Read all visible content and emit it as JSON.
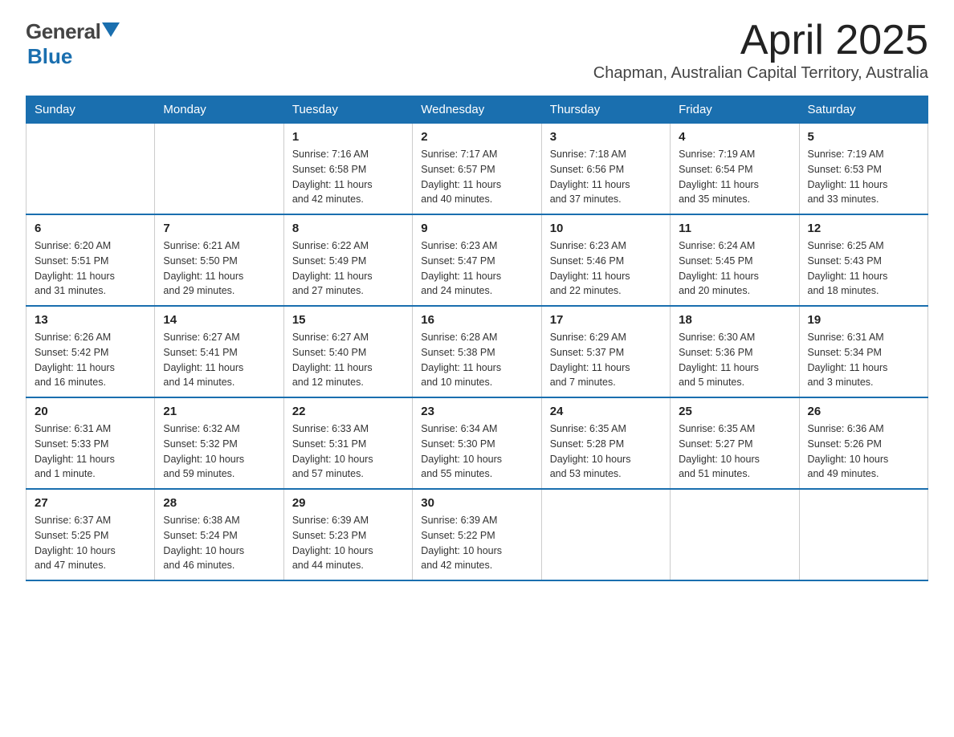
{
  "header": {
    "logo_general": "General",
    "logo_blue": "Blue",
    "month_title": "April 2025",
    "location": "Chapman, Australian Capital Territory, Australia"
  },
  "days_of_week": [
    "Sunday",
    "Monday",
    "Tuesday",
    "Wednesday",
    "Thursday",
    "Friday",
    "Saturday"
  ],
  "weeks": [
    [
      {
        "day": "",
        "info": ""
      },
      {
        "day": "",
        "info": ""
      },
      {
        "day": "1",
        "info": "Sunrise: 7:16 AM\nSunset: 6:58 PM\nDaylight: 11 hours\nand 42 minutes."
      },
      {
        "day": "2",
        "info": "Sunrise: 7:17 AM\nSunset: 6:57 PM\nDaylight: 11 hours\nand 40 minutes."
      },
      {
        "day": "3",
        "info": "Sunrise: 7:18 AM\nSunset: 6:56 PM\nDaylight: 11 hours\nand 37 minutes."
      },
      {
        "day": "4",
        "info": "Sunrise: 7:19 AM\nSunset: 6:54 PM\nDaylight: 11 hours\nand 35 minutes."
      },
      {
        "day": "5",
        "info": "Sunrise: 7:19 AM\nSunset: 6:53 PM\nDaylight: 11 hours\nand 33 minutes."
      }
    ],
    [
      {
        "day": "6",
        "info": "Sunrise: 6:20 AM\nSunset: 5:51 PM\nDaylight: 11 hours\nand 31 minutes."
      },
      {
        "day": "7",
        "info": "Sunrise: 6:21 AM\nSunset: 5:50 PM\nDaylight: 11 hours\nand 29 minutes."
      },
      {
        "day": "8",
        "info": "Sunrise: 6:22 AM\nSunset: 5:49 PM\nDaylight: 11 hours\nand 27 minutes."
      },
      {
        "day": "9",
        "info": "Sunrise: 6:23 AM\nSunset: 5:47 PM\nDaylight: 11 hours\nand 24 minutes."
      },
      {
        "day": "10",
        "info": "Sunrise: 6:23 AM\nSunset: 5:46 PM\nDaylight: 11 hours\nand 22 minutes."
      },
      {
        "day": "11",
        "info": "Sunrise: 6:24 AM\nSunset: 5:45 PM\nDaylight: 11 hours\nand 20 minutes."
      },
      {
        "day": "12",
        "info": "Sunrise: 6:25 AM\nSunset: 5:43 PM\nDaylight: 11 hours\nand 18 minutes."
      }
    ],
    [
      {
        "day": "13",
        "info": "Sunrise: 6:26 AM\nSunset: 5:42 PM\nDaylight: 11 hours\nand 16 minutes."
      },
      {
        "day": "14",
        "info": "Sunrise: 6:27 AM\nSunset: 5:41 PM\nDaylight: 11 hours\nand 14 minutes."
      },
      {
        "day": "15",
        "info": "Sunrise: 6:27 AM\nSunset: 5:40 PM\nDaylight: 11 hours\nand 12 minutes."
      },
      {
        "day": "16",
        "info": "Sunrise: 6:28 AM\nSunset: 5:38 PM\nDaylight: 11 hours\nand 10 minutes."
      },
      {
        "day": "17",
        "info": "Sunrise: 6:29 AM\nSunset: 5:37 PM\nDaylight: 11 hours\nand 7 minutes."
      },
      {
        "day": "18",
        "info": "Sunrise: 6:30 AM\nSunset: 5:36 PM\nDaylight: 11 hours\nand 5 minutes."
      },
      {
        "day": "19",
        "info": "Sunrise: 6:31 AM\nSunset: 5:34 PM\nDaylight: 11 hours\nand 3 minutes."
      }
    ],
    [
      {
        "day": "20",
        "info": "Sunrise: 6:31 AM\nSunset: 5:33 PM\nDaylight: 11 hours\nand 1 minute."
      },
      {
        "day": "21",
        "info": "Sunrise: 6:32 AM\nSunset: 5:32 PM\nDaylight: 10 hours\nand 59 minutes."
      },
      {
        "day": "22",
        "info": "Sunrise: 6:33 AM\nSunset: 5:31 PM\nDaylight: 10 hours\nand 57 minutes."
      },
      {
        "day": "23",
        "info": "Sunrise: 6:34 AM\nSunset: 5:30 PM\nDaylight: 10 hours\nand 55 minutes."
      },
      {
        "day": "24",
        "info": "Sunrise: 6:35 AM\nSunset: 5:28 PM\nDaylight: 10 hours\nand 53 minutes."
      },
      {
        "day": "25",
        "info": "Sunrise: 6:35 AM\nSunset: 5:27 PM\nDaylight: 10 hours\nand 51 minutes."
      },
      {
        "day": "26",
        "info": "Sunrise: 6:36 AM\nSunset: 5:26 PM\nDaylight: 10 hours\nand 49 minutes."
      }
    ],
    [
      {
        "day": "27",
        "info": "Sunrise: 6:37 AM\nSunset: 5:25 PM\nDaylight: 10 hours\nand 47 minutes."
      },
      {
        "day": "28",
        "info": "Sunrise: 6:38 AM\nSunset: 5:24 PM\nDaylight: 10 hours\nand 46 minutes."
      },
      {
        "day": "29",
        "info": "Sunrise: 6:39 AM\nSunset: 5:23 PM\nDaylight: 10 hours\nand 44 minutes."
      },
      {
        "day": "30",
        "info": "Sunrise: 6:39 AM\nSunset: 5:22 PM\nDaylight: 10 hours\nand 42 minutes."
      },
      {
        "day": "",
        "info": ""
      },
      {
        "day": "",
        "info": ""
      },
      {
        "day": "",
        "info": ""
      }
    ]
  ]
}
